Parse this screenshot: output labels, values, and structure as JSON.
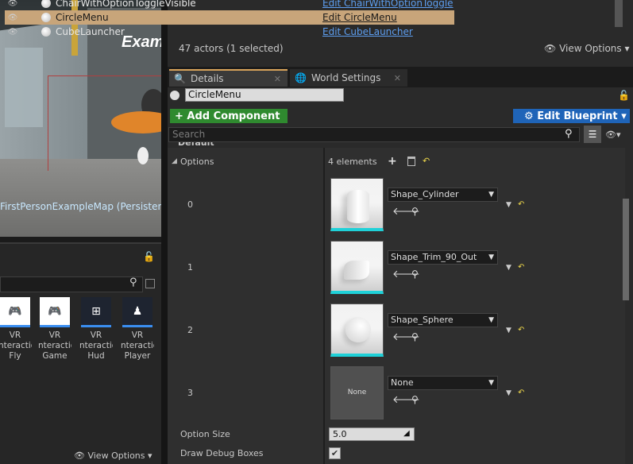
{
  "viewport": {
    "title_text": "Examp",
    "map_label": "FirstPersonExampleMap (Persistent)"
  },
  "outliner": {
    "rows": [
      {
        "name": "ChairWithOptionToggleVisible",
        "link": "Edit ChairWithOptionToggle"
      },
      {
        "name": "CircleMenu",
        "link": "Edit CircleMenu",
        "selected": true
      },
      {
        "name": "CubeLauncher",
        "link": "Edit CubeLauncher"
      }
    ],
    "count": "47 actors (1 selected)",
    "view_options": "View Options"
  },
  "tabs": {
    "details": "Details",
    "world_settings": "World Settings"
  },
  "details": {
    "actor_name": "CircleMenu",
    "add_component": "+ Add Component",
    "edit_blueprint": "Edit Blueprint",
    "search_placeholder": "Search",
    "section_header": "Default",
    "options_label": "Options",
    "options_count": "4 elements",
    "elements": [
      {
        "index": "0",
        "value": "Shape_Cylinder"
      },
      {
        "index": "1",
        "value": "Shape_Trim_90_Out"
      },
      {
        "index": "2",
        "value": "Shape_Sphere"
      },
      {
        "index": "3",
        "value": "None",
        "thumb_text": "None"
      }
    ],
    "option_size_label": "Option Size",
    "option_size_value": "5.0",
    "draw_debug_label": "Draw Debug Boxes",
    "draw_debug_checked": true
  },
  "content_browser": {
    "assets": [
      {
        "line1": "VR",
        "line2": "nteraction",
        "line3": "Fly"
      },
      {
        "line1": "VR",
        "line2": "nteraction",
        "line3": "Game"
      },
      {
        "line1": "VR",
        "line2": "nteraction",
        "line3": "Hud"
      },
      {
        "line1": "VR",
        "line2": "nteraction",
        "line3": "Player"
      }
    ],
    "view_options": "View Options"
  },
  "colors": {
    "selection": "#c8a57a",
    "add_component": "#2f8a2f",
    "edit_blueprint": "#1f64b8",
    "link": "#5d9ef0",
    "reset_arrow": "#ecd64b",
    "asset_underline": "#1fd1d8"
  }
}
